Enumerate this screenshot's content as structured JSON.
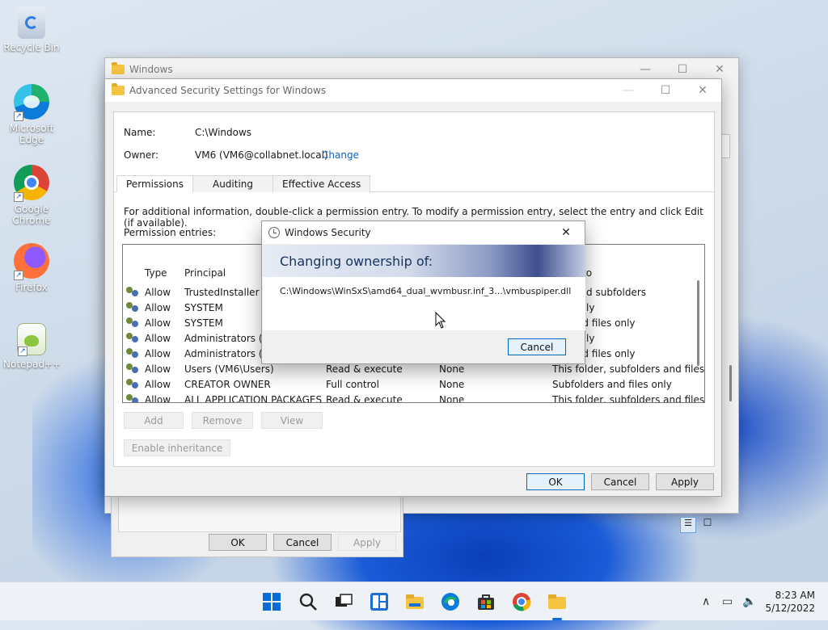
{
  "desktop": {
    "icons": [
      {
        "label": "Recycle Bin",
        "icon": "recycle-bin-icon"
      },
      {
        "label": "Microsoft Edge",
        "icon": "edge-icon"
      },
      {
        "label": "Google Chrome",
        "icon": "chrome-icon"
      },
      {
        "label": "Firefox",
        "icon": "firefox-icon"
      },
      {
        "label": "Notepad++",
        "icon": "notepadpp-icon"
      }
    ]
  },
  "background_window": {
    "title": "Windows"
  },
  "properties_window": {
    "ok_label": "OK",
    "cancel_label": "Cancel",
    "apply_label": "Apply"
  },
  "advanced": {
    "title": "Advanced Security Settings for Windows",
    "name_label": "Name:",
    "name_value": "C:\\Windows",
    "owner_label": "Owner:",
    "owner_value": "VM6 (VM6@collabnet.local)",
    "change_link": "Change",
    "tabs": [
      "Permissions",
      "Auditing",
      "Effective Access"
    ],
    "info_text": "For additional information, double-click a permission entry. To modify a permission entry, select the entry and click Edit (if available).",
    "entries_label": "Permission entries:",
    "columns": {
      "type": "Type",
      "principal": "Principal",
      "applies_to": "to"
    },
    "rows": [
      {
        "type": "Allow",
        "principal": "TrustedInstaller",
        "access": "",
        "inherited": "",
        "applies": "lder and subfolders"
      },
      {
        "type": "Allow",
        "principal": "SYSTEM",
        "access": "",
        "inherited": "",
        "applies": "lder only"
      },
      {
        "type": "Allow",
        "principal": "SYSTEM",
        "access": "",
        "inherited": "",
        "applies": "ers and files only"
      },
      {
        "type": "Allow",
        "principal": "Administrators (VM",
        "access": "",
        "inherited": "",
        "applies": "lder only"
      },
      {
        "type": "Allow",
        "principal": "Administrators (VM",
        "access": "",
        "inherited": "",
        "applies": "ers and files only"
      },
      {
        "type": "Allow",
        "principal": "Users (VM6\\Users)",
        "access": "Read & execute",
        "inherited": "None",
        "applies": "This folder, subfolders and files"
      },
      {
        "type": "Allow",
        "principal": "CREATOR OWNER",
        "access": "Full control",
        "inherited": "None",
        "applies": "Subfolders and files only"
      },
      {
        "type": "Allow",
        "principal": "ALL APPLICATION PACKAGES",
        "access": "Read & execute",
        "inherited": "None",
        "applies": "This folder, subfolders and files"
      }
    ],
    "add_label": "Add",
    "remove_label": "Remove",
    "view_label": "View",
    "enable_inheritance_label": "Enable inheritance",
    "ok_label": "OK",
    "cancel_label": "Cancel",
    "apply_label": "Apply"
  },
  "security_dialog": {
    "title": "Windows Security",
    "heading": "Changing ownership of:",
    "path": "C:\\Windows\\WinSxS\\amd64_dual_wvmbusr.inf_3...\\vmbuspiper.dll",
    "cancel_label": "Cancel"
  },
  "taskbar": {
    "time": "8:23 AM",
    "date": "5/12/2022"
  }
}
